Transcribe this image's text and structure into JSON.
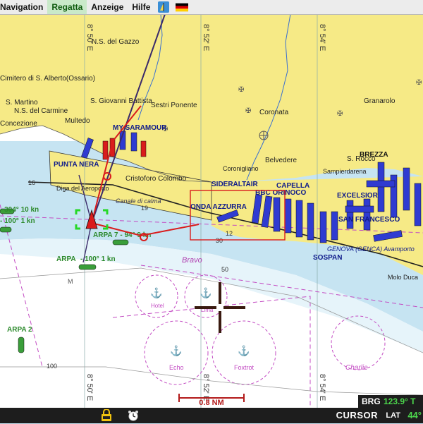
{
  "menu": {
    "items": [
      "Navigation",
      "Regatta",
      "Anzeige",
      "Hilfe"
    ],
    "active_index": 1
  },
  "icons": [
    "sailboat-icon",
    "german-flag-icon",
    "lock-battery-icon",
    "alarm-clock-icon"
  ],
  "map": {
    "longitude_labels": [
      "8° 50' E",
      "8° 52' E",
      "8° 54' E"
    ],
    "places": [
      "N.S. del Gazzo",
      "Cimitero di S. Alberto(Ossario)",
      "S. Martino",
      "N.S. del Carmine",
      "S. Giovanni Battista",
      "Sestri Ponente",
      "Multedo",
      "Coronata",
      "Granarolo",
      "Belvedere",
      "Coronigliano",
      "Sampierdarena",
      "S. Rocco",
      "BREZZA",
      "Cristoforo Colombo",
      "Diga del Aeroporto",
      "Canale di calma",
      "Bravo",
      "Hotel",
      "Lima",
      "Echo",
      "Foxtrot",
      "Charlie",
      "Concezione",
      "Molo Duca"
    ],
    "vessels": [
      "PUNTA NERA",
      "MY SARAMOUR",
      "SIDERALTAIR",
      "BBC ORINOCO",
      "CAPELLA",
      "ONDA AZZURRA",
      "EXCELSIOR",
      "SAN FRANCESCO",
      "SOSPAN",
      "GENOVA (GENCA) Avamporto"
    ],
    "arpa": [
      "ARPA 7 - 94° 9 kn",
      "ARPA 2",
      "- 100° 1 kn",
      "- 304° 10 kn",
      "- 100° 1 kn"
    ],
    "soundings": [
      "19",
      "12",
      "16",
      "50",
      "M",
      "100",
      "30"
    ],
    "scale_label": "0.8 NM",
    "colors": {
      "land": "#f6ea86",
      "shallow": "#c6e4f2",
      "deep": "#ffffff",
      "route": "#d91c1c",
      "vessel": "#2f3bd1",
      "arpa": "#3a9e3a"
    }
  },
  "brg": {
    "label": "BRG",
    "value": "123.9° T"
  },
  "status": {
    "mode": "CURSOR",
    "lat_label": "LAT",
    "lat_value": "44°"
  }
}
